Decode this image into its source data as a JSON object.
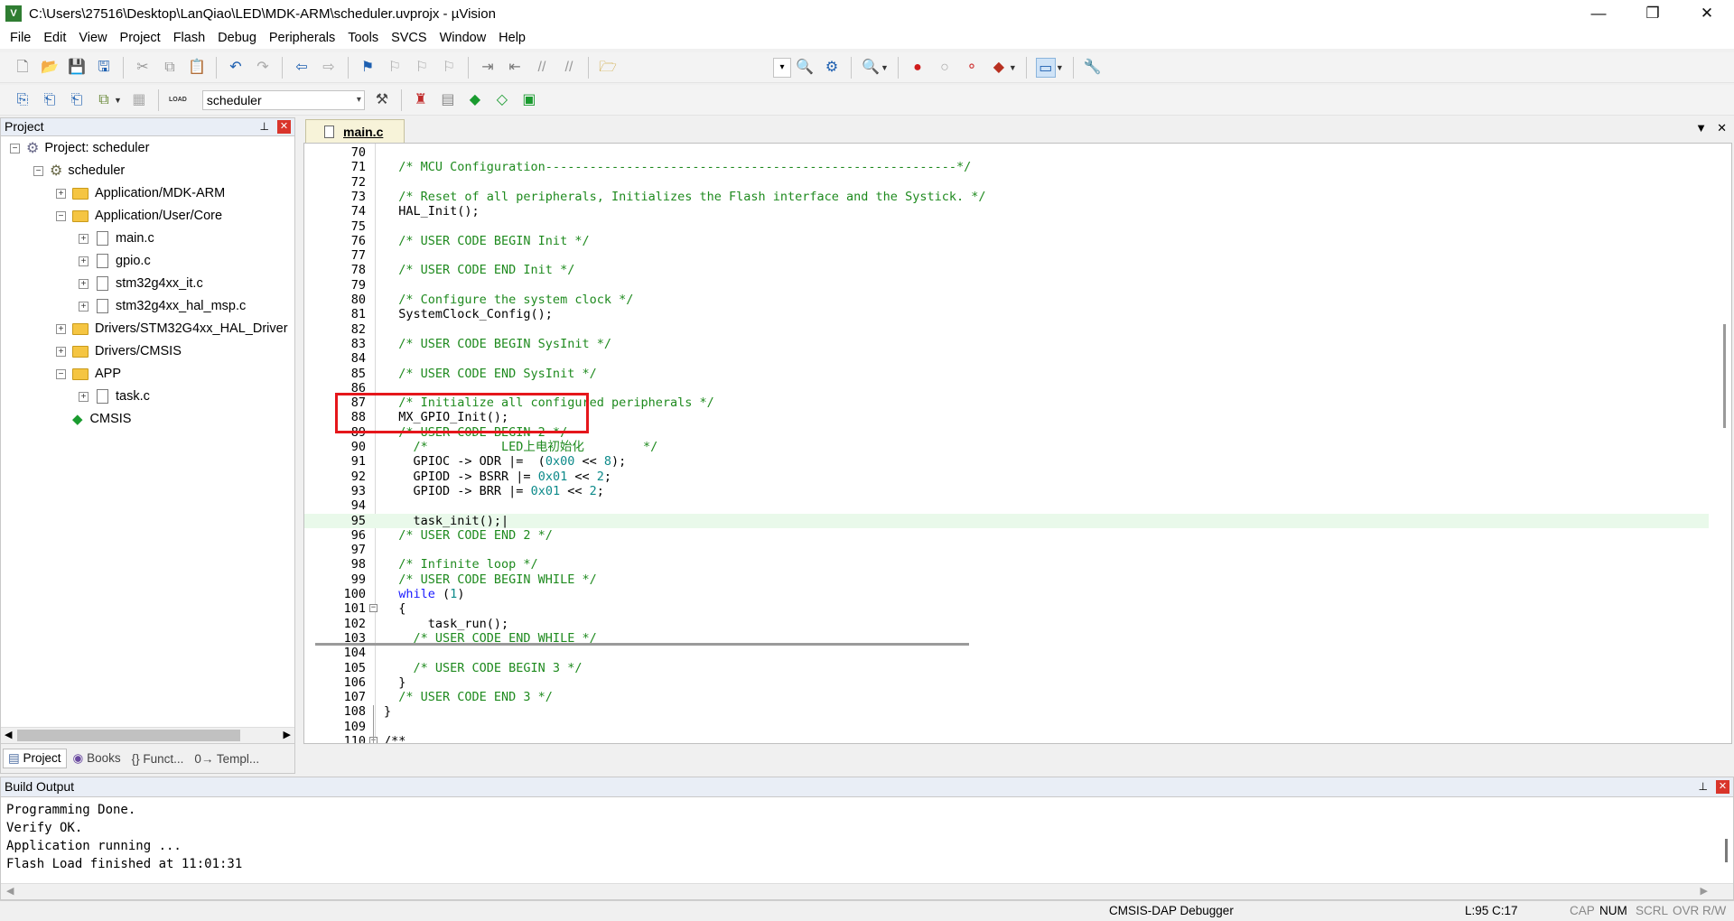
{
  "window": {
    "title": "C:\\Users\\27516\\Desktop\\LanQiao\\LED\\MDK-ARM\\scheduler.uvprojx - µVision",
    "icon_text": "V",
    "controls": {
      "minimize": "—",
      "maximize": "❐",
      "close": "✕"
    }
  },
  "menu": [
    "File",
    "Edit",
    "View",
    "Project",
    "Flash",
    "Debug",
    "Peripherals",
    "Tools",
    "SVCS",
    "Window",
    "Help"
  ],
  "toolbar": {
    "target_value": "scheduler",
    "load_label": "LOAD"
  },
  "project_panel": {
    "title": "Project",
    "pin": "⊥",
    "close": "✕",
    "tree": [
      {
        "label": "Project: scheduler",
        "level": 0,
        "icon": "project-icon",
        "expander": "−"
      },
      {
        "label": "scheduler",
        "level": 1,
        "icon": "target-gear-icon",
        "expander": "−"
      },
      {
        "label": "Application/MDK-ARM",
        "level": 2,
        "icon": "folder-icon",
        "expander": "+"
      },
      {
        "label": "Application/User/Core",
        "level": 2,
        "icon": "folder-open-icon",
        "expander": "−"
      },
      {
        "label": "main.c",
        "level": 3,
        "icon": "file-icon",
        "expander": "+"
      },
      {
        "label": "gpio.c",
        "level": 3,
        "icon": "file-icon",
        "expander": "+"
      },
      {
        "label": "stm32g4xx_it.c",
        "level": 3,
        "icon": "file-icon",
        "expander": "+"
      },
      {
        "label": "stm32g4xx_hal_msp.c",
        "level": 3,
        "icon": "file-icon",
        "expander": "+"
      },
      {
        "label": "Drivers/STM32G4xx_HAL_Driver",
        "level": 2,
        "icon": "folder-icon",
        "expander": "+"
      },
      {
        "label": "Drivers/CMSIS",
        "level": 2,
        "icon": "folder-icon",
        "expander": "+"
      },
      {
        "label": "APP",
        "level": 2,
        "icon": "folder-open-icon",
        "expander": "−"
      },
      {
        "label": "task.c",
        "level": 3,
        "icon": "file-icon",
        "expander": "+"
      },
      {
        "label": "CMSIS",
        "level": 2,
        "icon": "cmsis-diamond-icon",
        "expander": ""
      }
    ],
    "tabs": [
      {
        "label": "Project",
        "active": true
      },
      {
        "label": "Books",
        "active": false
      },
      {
        "label": "{} Funct...",
        "active": false
      },
      {
        "label": "0→ Templ...",
        "active": false
      }
    ]
  },
  "editor": {
    "tab_label": "main.c",
    "tab_menu": "▼",
    "tab_close": "✕",
    "lines": [
      {
        "n": "70",
        "parts": []
      },
      {
        "n": "71",
        "parts": [
          [
            "cm",
            "  /* MCU Configuration--------------------------------------------------------*/"
          ]
        ]
      },
      {
        "n": "72",
        "parts": []
      },
      {
        "n": "73",
        "parts": [
          [
            "cm",
            "  /* Reset of all peripherals, Initializes the Flash interface and the Systick. */"
          ]
        ]
      },
      {
        "n": "74",
        "parts": [
          [
            "tx",
            "  HAL_Init();"
          ]
        ]
      },
      {
        "n": "75",
        "parts": []
      },
      {
        "n": "76",
        "parts": [
          [
            "cm",
            "  /* USER CODE BEGIN Init */"
          ]
        ]
      },
      {
        "n": "77",
        "parts": []
      },
      {
        "n": "78",
        "parts": [
          [
            "cm",
            "  /* USER CODE END Init */"
          ]
        ]
      },
      {
        "n": "79",
        "parts": []
      },
      {
        "n": "80",
        "parts": [
          [
            "cm",
            "  /* Configure the system clock */"
          ]
        ]
      },
      {
        "n": "81",
        "parts": [
          [
            "tx",
            "  SystemClock_Config();"
          ]
        ]
      },
      {
        "n": "82",
        "parts": []
      },
      {
        "n": "83",
        "parts": [
          [
            "cm",
            "  /* USER CODE BEGIN SysInit */"
          ]
        ]
      },
      {
        "n": "84",
        "parts": []
      },
      {
        "n": "85",
        "parts": [
          [
            "cm",
            "  /* USER CODE END SysInit */"
          ]
        ]
      },
      {
        "n": "86",
        "parts": []
      },
      {
        "n": "87",
        "parts": [
          [
            "cm",
            "  /* Initialize all configured peripherals */"
          ]
        ]
      },
      {
        "n": "88",
        "parts": [
          [
            "tx",
            "  MX_GPIO_Init();"
          ]
        ]
      },
      {
        "n": "89",
        "parts": [
          [
            "cm",
            "  /* USER CODE BEGIN 2 */"
          ]
        ]
      },
      {
        "n": "90",
        "parts": [
          [
            "cm",
            "    /*          LED上电初始化        */"
          ]
        ]
      },
      {
        "n": "91",
        "parts": [
          [
            "tx",
            "    GPIOC -> ODR |=  ("
          ],
          [
            "num",
            "0x00"
          ],
          [
            "tx",
            " << "
          ],
          [
            "num",
            "8"
          ],
          [
            "tx",
            ");"
          ]
        ]
      },
      {
        "n": "92",
        "parts": [
          [
            "tx",
            "    GPIOD -> BSRR |= "
          ],
          [
            "num",
            "0x01"
          ],
          [
            "tx",
            " << "
          ],
          [
            "num",
            "2"
          ],
          [
            "tx",
            ";"
          ]
        ]
      },
      {
        "n": "93",
        "parts": [
          [
            "tx",
            "    GPIOD -> BRR |= "
          ],
          [
            "num",
            "0x01"
          ],
          [
            "tx",
            " << "
          ],
          [
            "num",
            "2"
          ],
          [
            "tx",
            ";"
          ]
        ]
      },
      {
        "n": "94",
        "parts": []
      },
      {
        "n": "95",
        "parts": [
          [
            "tx",
            "    task_init();|"
          ]
        ],
        "current": true
      },
      {
        "n": "96",
        "parts": [
          [
            "cm",
            "  /* USER CODE END 2 */"
          ]
        ]
      },
      {
        "n": "97",
        "parts": []
      },
      {
        "n": "98",
        "parts": [
          [
            "cm",
            "  /* Infinite loop */"
          ]
        ]
      },
      {
        "n": "99",
        "parts": [
          [
            "cm",
            "  /* USER CODE BEGIN WHILE */"
          ]
        ]
      },
      {
        "n": "100",
        "parts": [
          [
            "kw",
            "  while"
          ],
          [
            "tx",
            " ("
          ],
          [
            "num",
            "1"
          ],
          [
            "tx",
            ")"
          ]
        ]
      },
      {
        "n": "101",
        "parts": [
          [
            "tx",
            "  {"
          ]
        ],
        "fold": "−"
      },
      {
        "n": "102",
        "parts": [
          [
            "tx",
            "      task_run();"
          ]
        ]
      },
      {
        "n": "103",
        "parts": [
          [
            "cm",
            "    /* USER CODE END WHILE */"
          ]
        ]
      },
      {
        "n": "104",
        "parts": []
      },
      {
        "n": "105",
        "parts": [
          [
            "cm",
            "    /* USER CODE BEGIN 3 */"
          ]
        ]
      },
      {
        "n": "106",
        "parts": [
          [
            "tx",
            "  }"
          ]
        ]
      },
      {
        "n": "107",
        "parts": [
          [
            "cm",
            "  /* USER CODE END 3 */"
          ]
        ]
      },
      {
        "n": "108",
        "parts": [
          [
            "tx",
            "}"
          ]
        ]
      },
      {
        "n": "109",
        "parts": []
      },
      {
        "n": "110",
        "parts": [
          [
            "tx",
            "/**"
          ]
        ],
        "fold": "−"
      }
    ]
  },
  "build_output": {
    "title": "Build Output",
    "pin": "⊥",
    "close": "✕",
    "lines": [
      "Programming Done.",
      "Verify OK.",
      "Application running ...",
      "Flash Load finished at 11:01:31"
    ]
  },
  "statusbar": {
    "debugger": "CMSIS-DAP Debugger",
    "position": "L:95 C:17",
    "keys": [
      {
        "label": "CAP",
        "on": false
      },
      {
        "label": "NUM",
        "on": true
      },
      {
        "label": "SCRL",
        "on": false
      },
      {
        "label": "OVR",
        "on": false
      },
      {
        "label": "R/W",
        "on": false
      }
    ]
  }
}
